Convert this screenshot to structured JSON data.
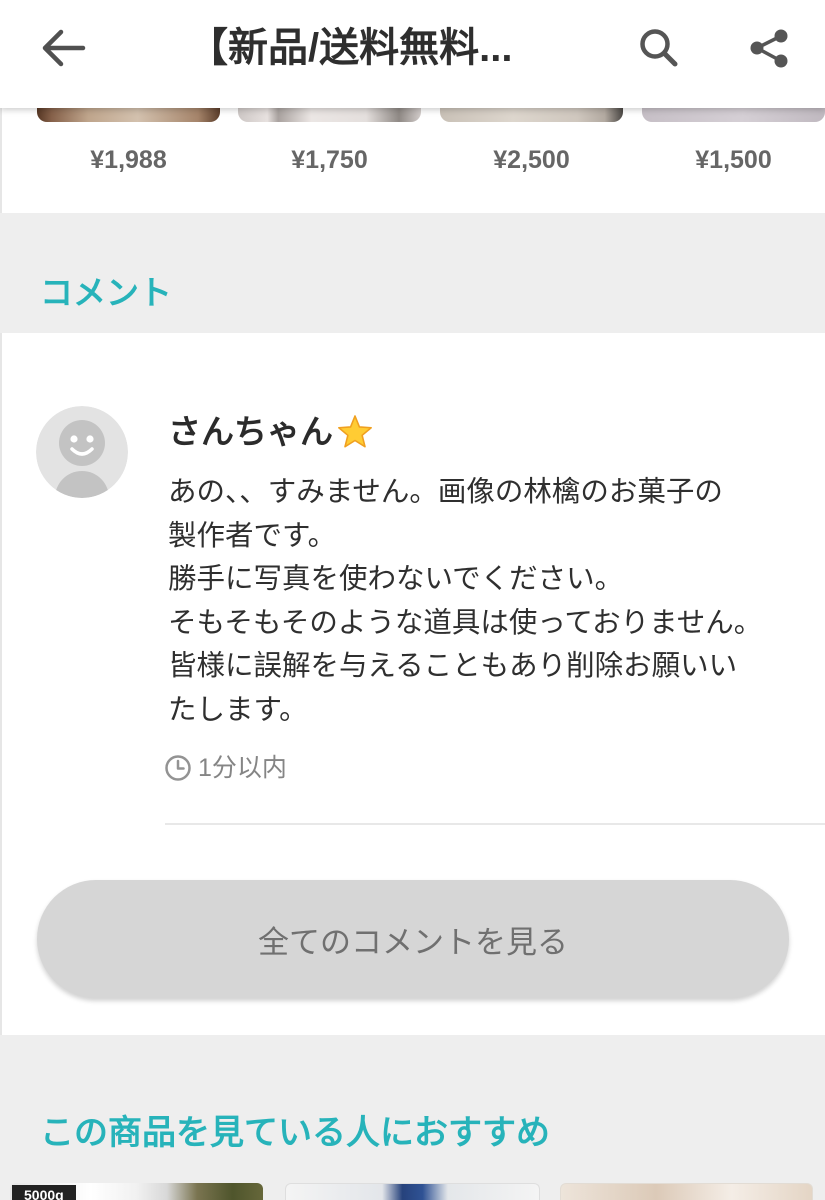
{
  "theme": {
    "accent": "#27b3ba",
    "section_bg": "#eeeeee",
    "text": "#333333",
    "muted": "#808080"
  },
  "header": {
    "title": "【新品/送料無料...",
    "back_icon": "arrow-left-icon",
    "search_icon": "search-icon",
    "share_icon": "share-icon"
  },
  "related_items": [
    {
      "price": "¥1,988"
    },
    {
      "price": "¥1,750"
    },
    {
      "price": "¥2,500"
    },
    {
      "price": "¥1,500"
    }
  ],
  "comments_section": {
    "heading": "コメント",
    "comments": [
      {
        "avatar_icon": "default-avatar-icon",
        "username": "さんちゃん",
        "badge_icon": "star-icon",
        "lines": [
          "あの、、すみません。画像の林檎のお菓子の",
          "製作者です。",
          "勝手に写真を使わないでください。",
          "そもそもそのような道具は使っておりません。",
          "皆様に誤解を与えることもあり削除お願いい",
          "たします。"
        ],
        "time_icon": "clock-icon",
        "time": "1分以内"
      }
    ],
    "view_all_label": "全てのコメントを見る"
  },
  "recommend_section": {
    "heading": "この商品を見ている人におすすめ",
    "items": [
      {
        "label": "5000g"
      },
      {},
      {}
    ]
  }
}
